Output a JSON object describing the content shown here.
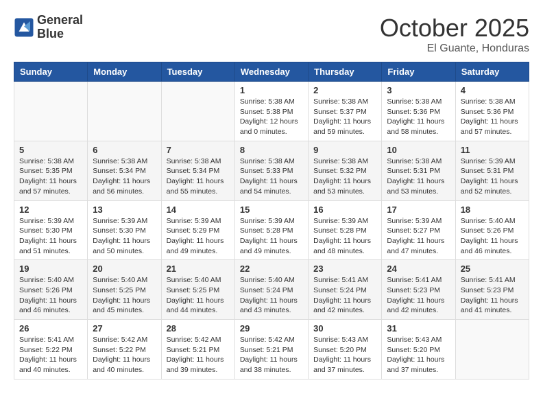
{
  "header": {
    "logo_line1": "General",
    "logo_line2": "Blue",
    "month": "October 2025",
    "location": "El Guante, Honduras"
  },
  "weekdays": [
    "Sunday",
    "Monday",
    "Tuesday",
    "Wednesday",
    "Thursday",
    "Friday",
    "Saturday"
  ],
  "weeks": [
    [
      {
        "day": "",
        "info": ""
      },
      {
        "day": "",
        "info": ""
      },
      {
        "day": "",
        "info": ""
      },
      {
        "day": "1",
        "info": "Sunrise: 5:38 AM\nSunset: 5:38 PM\nDaylight: 12 hours\nand 0 minutes."
      },
      {
        "day": "2",
        "info": "Sunrise: 5:38 AM\nSunset: 5:37 PM\nDaylight: 11 hours\nand 59 minutes."
      },
      {
        "day": "3",
        "info": "Sunrise: 5:38 AM\nSunset: 5:36 PM\nDaylight: 11 hours\nand 58 minutes."
      },
      {
        "day": "4",
        "info": "Sunrise: 5:38 AM\nSunset: 5:36 PM\nDaylight: 11 hours\nand 57 minutes."
      }
    ],
    [
      {
        "day": "5",
        "info": "Sunrise: 5:38 AM\nSunset: 5:35 PM\nDaylight: 11 hours\nand 57 minutes."
      },
      {
        "day": "6",
        "info": "Sunrise: 5:38 AM\nSunset: 5:34 PM\nDaylight: 11 hours\nand 56 minutes."
      },
      {
        "day": "7",
        "info": "Sunrise: 5:38 AM\nSunset: 5:34 PM\nDaylight: 11 hours\nand 55 minutes."
      },
      {
        "day": "8",
        "info": "Sunrise: 5:38 AM\nSunset: 5:33 PM\nDaylight: 11 hours\nand 54 minutes."
      },
      {
        "day": "9",
        "info": "Sunrise: 5:38 AM\nSunset: 5:32 PM\nDaylight: 11 hours\nand 53 minutes."
      },
      {
        "day": "10",
        "info": "Sunrise: 5:38 AM\nSunset: 5:31 PM\nDaylight: 11 hours\nand 53 minutes."
      },
      {
        "day": "11",
        "info": "Sunrise: 5:39 AM\nSunset: 5:31 PM\nDaylight: 11 hours\nand 52 minutes."
      }
    ],
    [
      {
        "day": "12",
        "info": "Sunrise: 5:39 AM\nSunset: 5:30 PM\nDaylight: 11 hours\nand 51 minutes."
      },
      {
        "day": "13",
        "info": "Sunrise: 5:39 AM\nSunset: 5:30 PM\nDaylight: 11 hours\nand 50 minutes."
      },
      {
        "day": "14",
        "info": "Sunrise: 5:39 AM\nSunset: 5:29 PM\nDaylight: 11 hours\nand 49 minutes."
      },
      {
        "day": "15",
        "info": "Sunrise: 5:39 AM\nSunset: 5:28 PM\nDaylight: 11 hours\nand 49 minutes."
      },
      {
        "day": "16",
        "info": "Sunrise: 5:39 AM\nSunset: 5:28 PM\nDaylight: 11 hours\nand 48 minutes."
      },
      {
        "day": "17",
        "info": "Sunrise: 5:39 AM\nSunset: 5:27 PM\nDaylight: 11 hours\nand 47 minutes."
      },
      {
        "day": "18",
        "info": "Sunrise: 5:40 AM\nSunset: 5:26 PM\nDaylight: 11 hours\nand 46 minutes."
      }
    ],
    [
      {
        "day": "19",
        "info": "Sunrise: 5:40 AM\nSunset: 5:26 PM\nDaylight: 11 hours\nand 46 minutes."
      },
      {
        "day": "20",
        "info": "Sunrise: 5:40 AM\nSunset: 5:25 PM\nDaylight: 11 hours\nand 45 minutes."
      },
      {
        "day": "21",
        "info": "Sunrise: 5:40 AM\nSunset: 5:25 PM\nDaylight: 11 hours\nand 44 minutes."
      },
      {
        "day": "22",
        "info": "Sunrise: 5:40 AM\nSunset: 5:24 PM\nDaylight: 11 hours\nand 43 minutes."
      },
      {
        "day": "23",
        "info": "Sunrise: 5:41 AM\nSunset: 5:24 PM\nDaylight: 11 hours\nand 42 minutes."
      },
      {
        "day": "24",
        "info": "Sunrise: 5:41 AM\nSunset: 5:23 PM\nDaylight: 11 hours\nand 42 minutes."
      },
      {
        "day": "25",
        "info": "Sunrise: 5:41 AM\nSunset: 5:23 PM\nDaylight: 11 hours\nand 41 minutes."
      }
    ],
    [
      {
        "day": "26",
        "info": "Sunrise: 5:41 AM\nSunset: 5:22 PM\nDaylight: 11 hours\nand 40 minutes."
      },
      {
        "day": "27",
        "info": "Sunrise: 5:42 AM\nSunset: 5:22 PM\nDaylight: 11 hours\nand 40 minutes."
      },
      {
        "day": "28",
        "info": "Sunrise: 5:42 AM\nSunset: 5:21 PM\nDaylight: 11 hours\nand 39 minutes."
      },
      {
        "day": "29",
        "info": "Sunrise: 5:42 AM\nSunset: 5:21 PM\nDaylight: 11 hours\nand 38 minutes."
      },
      {
        "day": "30",
        "info": "Sunrise: 5:43 AM\nSunset: 5:20 PM\nDaylight: 11 hours\nand 37 minutes."
      },
      {
        "day": "31",
        "info": "Sunrise: 5:43 AM\nSunset: 5:20 PM\nDaylight: 11 hours\nand 37 minutes."
      },
      {
        "day": "",
        "info": ""
      }
    ]
  ]
}
